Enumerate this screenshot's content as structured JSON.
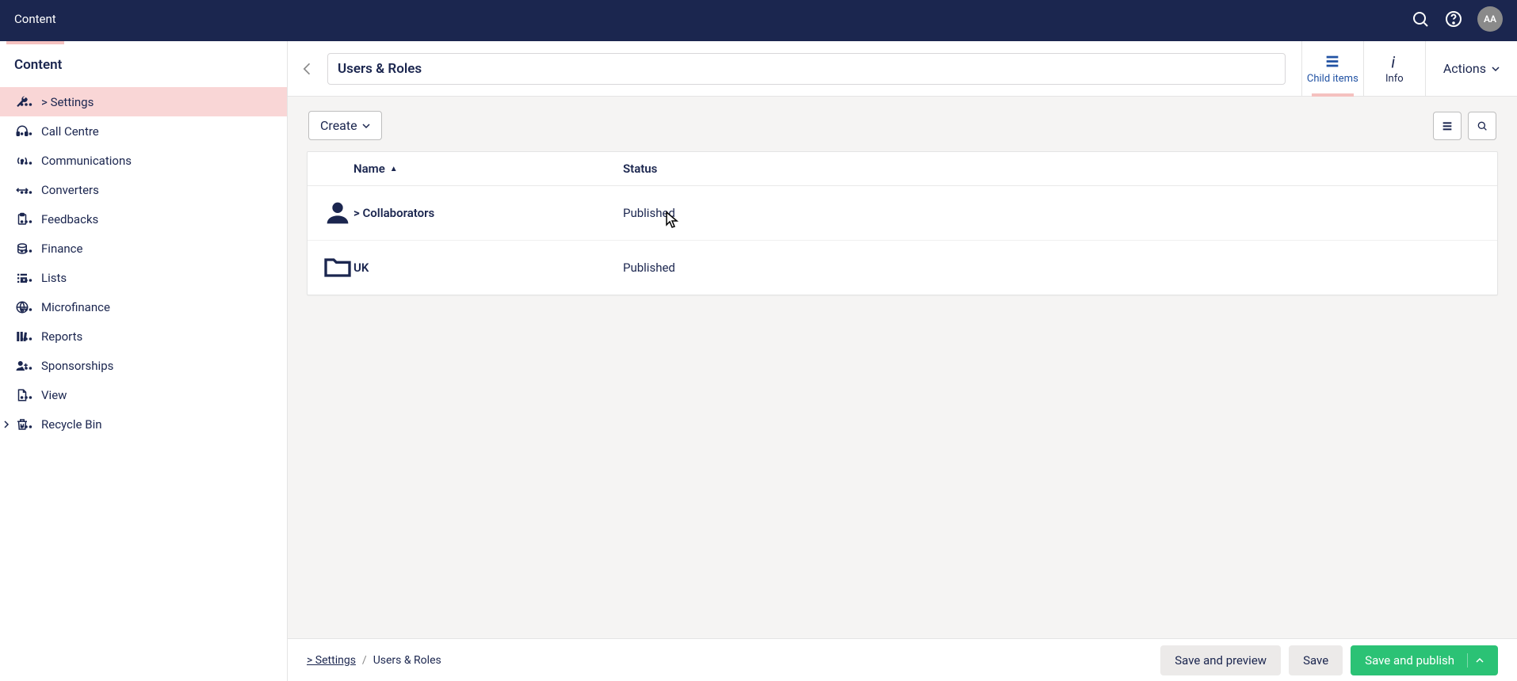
{
  "topbar": {
    "title": "Content",
    "avatar": "AA"
  },
  "sidebar": {
    "header": "Content",
    "items": [
      {
        "label": "> Settings",
        "name": "settings",
        "icon": "wrench",
        "selected": true
      },
      {
        "label": "Call Centre",
        "name": "call-centre",
        "icon": "headset"
      },
      {
        "label": "Communications",
        "name": "communications",
        "icon": "broadcast"
      },
      {
        "label": "Converters",
        "name": "converters",
        "icon": "arrows-h"
      },
      {
        "label": "Feedbacks",
        "name": "feedbacks",
        "icon": "clipboard"
      },
      {
        "label": "Finance",
        "name": "finance",
        "icon": "coins"
      },
      {
        "label": "Lists",
        "name": "lists",
        "icon": "list"
      },
      {
        "label": "Microfinance",
        "name": "microfinance",
        "icon": "globe"
      },
      {
        "label": "Reports",
        "name": "reports",
        "icon": "books"
      },
      {
        "label": "Sponsorships",
        "name": "sponsorships",
        "icon": "user-plus"
      },
      {
        "label": "View",
        "name": "view",
        "icon": "file"
      },
      {
        "label": "Recycle Bin",
        "name": "recycle-bin",
        "icon": "trash",
        "hasChildren": true
      }
    ]
  },
  "editor": {
    "title": "Users & Roles",
    "tabs": {
      "child_items": "Child items",
      "info": "Info"
    },
    "actions_label": "Actions"
  },
  "toolbar": {
    "create": "Create"
  },
  "list": {
    "columns": {
      "name": "Name",
      "status": "Status"
    },
    "rows": [
      {
        "name": "> Collaborators",
        "status": "Published",
        "icon": "user"
      },
      {
        "name": "UK",
        "status": "Published",
        "icon": "folder"
      }
    ]
  },
  "breadcrumb": {
    "settings": "> Settings",
    "current": "Users & Roles"
  },
  "footer": {
    "save_preview": "Save and preview",
    "save": "Save",
    "save_publish": "Save and publish"
  }
}
